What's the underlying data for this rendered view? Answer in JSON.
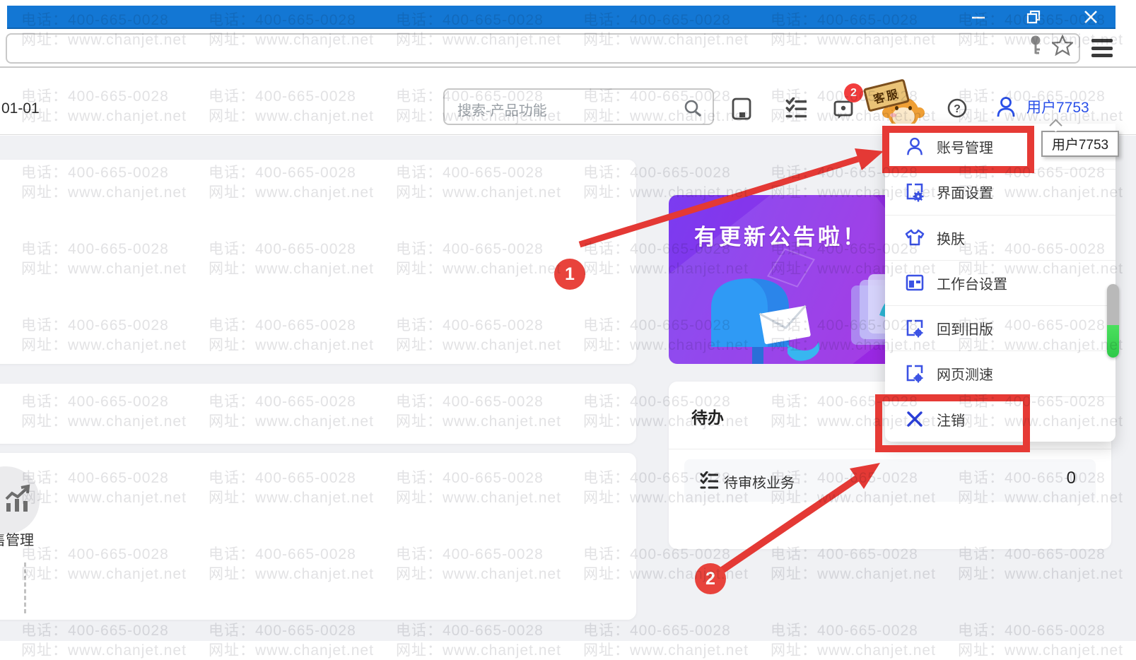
{
  "watermark": {
    "line1": "电话：400-665-0028",
    "line2": "网址：www.chanjet.net"
  },
  "titlebar": {
    "minimize": "minimize",
    "restore": "restore",
    "close": "close"
  },
  "header": {
    "date_fragment": "01-01",
    "search_placeholder": "搜索-产品功能",
    "messages_badge": "2",
    "mascot_label": "客服",
    "username": "用户7753"
  },
  "tooltip": {
    "text": "用户7753"
  },
  "user_menu": {
    "items": [
      {
        "label": "账号管理",
        "icon": "user-icon"
      },
      {
        "label": "界面设置",
        "icon": "interface-settings-icon"
      },
      {
        "label": "换肤",
        "icon": "tshirt-icon"
      },
      {
        "label": "工作台设置",
        "icon": "workbench-icon"
      },
      {
        "label": "回到旧版",
        "icon": "old-version-icon"
      },
      {
        "label": "网页测速",
        "icon": "speed-test-icon"
      },
      {
        "label": "注销",
        "icon": "logout-x-icon"
      }
    ]
  },
  "banner": {
    "title": "有更新公告啦！"
  },
  "todo": {
    "title": "待办",
    "rows": [
      {
        "label": "待审核业务",
        "value": "0"
      }
    ]
  },
  "left_panel": {
    "section_label": "售管理"
  },
  "annotations": {
    "badge1": "1",
    "badge2": "2"
  },
  "colors": {
    "titlebar_blue": "#1377D4",
    "annotation_red": "#E63A35",
    "badge_red": "#E8433C",
    "menu_icon_blue": "#3B52E4",
    "username_blue": "#2A50E8",
    "banner_purple_start": "#7B3CF0",
    "banner_purple_end": "#A81DDD",
    "scroll_green": "#2EC948",
    "content_bg": "#F0F1F4"
  }
}
